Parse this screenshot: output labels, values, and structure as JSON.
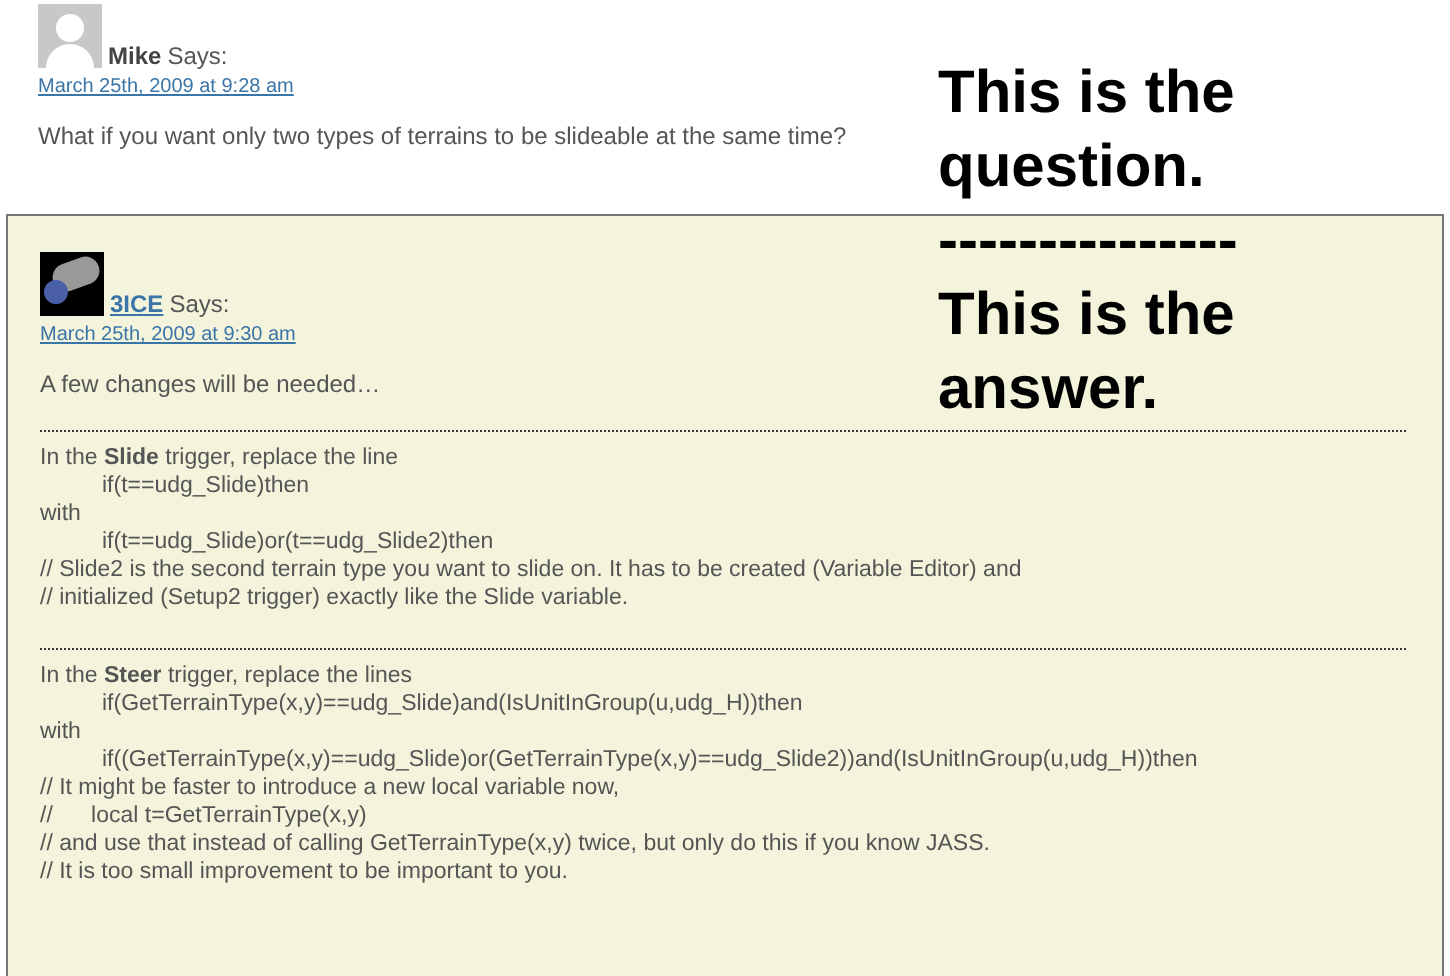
{
  "question": {
    "author": "Mike",
    "says": "Says:",
    "date": "March 25th, 2009 at 9:28 am",
    "text": "What if you want only two types of terrains to be slideable at the same time?"
  },
  "answer": {
    "author": "3ICE",
    "says": "Says:",
    "date": "March 25th, 2009 at 9:30 am",
    "intro": "A few changes will be needed…",
    "blocks": [
      {
        "lines": [
          {
            "kind": "text",
            "text": "In the **Slide** trigger, replace the line"
          },
          {
            "kind": "code",
            "text": "if(t==udg_Slide)then"
          },
          {
            "kind": "text",
            "text": "with"
          },
          {
            "kind": "code",
            "text": "if(t==udg_Slide)or(t==udg_Slide2)then"
          },
          {
            "kind": "text",
            "text": "// Slide2 is the second terrain type you want to slide on. It has to be created (Variable Editor) and"
          },
          {
            "kind": "text",
            "text": "// initialized (Setup2 trigger) exactly like the Slide variable."
          }
        ]
      },
      {
        "lines": [
          {
            "kind": "text",
            "text": "In the **Steer** trigger, replace the lines"
          },
          {
            "kind": "code",
            "text": "if(GetTerrainType(x,y)==udg_Slide)and(IsUnitInGroup(u,udg_H))then"
          },
          {
            "kind": "text",
            "text": "with"
          },
          {
            "kind": "code",
            "text": "if((GetTerrainType(x,y)==udg_Slide)or(GetTerrainType(x,y)==udg_Slide2))and(IsUnitInGroup(u,udg_H))then"
          },
          {
            "kind": "text",
            "text": "// It might be faster to introduce a new local variable now,"
          },
          {
            "kind": "text",
            "text": "//      local t=GetTerrainType(x,y)"
          },
          {
            "kind": "text",
            "text": "// and use that instead of calling GetTerrainType(x,y) twice, but only do this if you know JASS."
          },
          {
            "kind": "text",
            "text": "// It is too small improvement to be important to you."
          }
        ]
      }
    ]
  },
  "annotation": [
    "This is the",
    "question.",
    "---------------",
    "This is the",
    "answer."
  ]
}
